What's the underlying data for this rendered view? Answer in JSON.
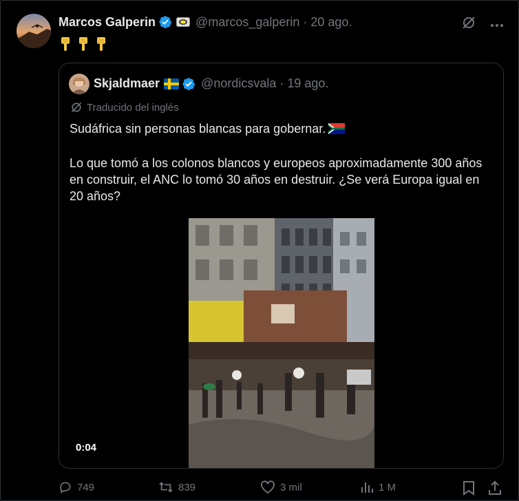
{
  "post": {
    "author_name": "Marcos Galperin",
    "handle": "@marcos_galperin",
    "separator": "·",
    "date": "20 ago.",
    "emoji_text": "👇👇👇"
  },
  "quoted": {
    "author_name": "Skjaldmaer",
    "handle": "@nordicsvala",
    "separator": "·",
    "date": "19 ago.",
    "translation_note": "Traducido del inglés",
    "paragraph_1": "Sudáfrica sin personas blancas para gobernar.",
    "paragraph_2": "Lo que tomó a los colonos blancos y europeos aproximadamente 300 años en construir, el ANC lo tomó 30 años en destruir. ¿Se verá Europa igual en 20 años?",
    "video_time": "0:04"
  },
  "actions": {
    "replies": "749",
    "reposts": "839",
    "likes": "3 mil",
    "views": "1 M"
  },
  "colors": {
    "background": "#000000",
    "text": "#e7e9ea",
    "muted": "#71767b",
    "border": "#2f3336",
    "verified": "#1d9bf0"
  },
  "icons": [
    "grok-icon",
    "more-icon",
    "verified-badge-icon",
    "reply-icon",
    "repost-icon",
    "like-icon",
    "views-icon",
    "bookmark-icon",
    "share-icon"
  ]
}
